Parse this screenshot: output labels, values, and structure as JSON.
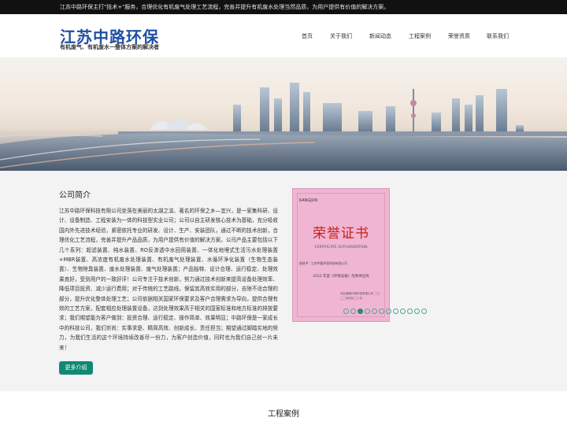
{
  "topbar": {
    "text": "江苏中路环保主打\"技术+\"服务，合理优化有机废气处理工艺流程，完善并提升有机废水处理当然品质，为用户提供有价值的解决方案。"
  },
  "header": {
    "logo_title": "江苏中路环保",
    "logo_subtitle": "有机废气、有机废水一整体方案的解决者",
    "nav": [
      "首页",
      "关于我们",
      "新闻动态",
      "工程案例",
      "荣誉资质",
      "联系我们"
    ]
  },
  "intro": {
    "title": "公司简介",
    "text": "江苏中路环保科技有限公司坐落在美丽的太湖之滨、著名的环保之乡—宜兴，是一家集科研、设计、设备制造、工程安装为一体的科技型实业公司；公司以自主研发核心技术为基础，充分吸收国内外先进技术经验，紧密依托专业的研发、设计、生产、安装团队，通过不断的技术创新，合理优化工艺流程，完善并提升产品品质，为用户提供有价值的解决方案。公司产品主要包括以下几个系列：超滤装置、纯水装置、RO反渗透中水回用装置、一体化地埋式生活污水处理装置+MBR装置、高浓度有机废水处理装置、有机废气处理装置、水循环净化装置（生物生态装置）、生物除臭装置、废水处理装置、废气处理装置；产品独特、设计合理、运行稳定、处理效果良好，受到用户的一致好评！公司专注于技术创新，努力通过技术创新来提高设备处理效率、降低项目投资、减少运行费用；对于传统的工艺路线，保留其高效实用的部分，去除不适合理的部分，提升优化整体处理工艺；公司依据相关国家环保要求及客户合理需求为导向，提供合理有效的工艺方案，配套相应处理装置设备，达到处理效果高于相关的国家标准和地方标准的排放要求；我们期望能为客户做到：投资合理、运行稳定、操作简单、效果明显；中路环保是一家成长中的科技公司，我们崇尚：实事求是、精简高效、创新成长、责任担当；期望通过脚踏实地的努力，为我们生活的这个环境持续改善尽一份力，为客户创造价值，同时也为我们自己创一片未来！",
    "more_button": "更多介绍"
  },
  "certificate": {
    "brand": "KANGJUN",
    "title": "荣誉证书",
    "english": "CERTIFICATE AUTHORIZATION",
    "line1": "兹授予：江苏中路环保科技有限公司",
    "line2": "2022 年度《环保设备》优秀供应商",
    "footer": "河北康骏环保科技有限公司 二〇二二年四月二十日"
  },
  "carousel": {
    "dot_count": 12,
    "active_index": 2
  },
  "cases": {
    "title": "工程案例"
  }
}
